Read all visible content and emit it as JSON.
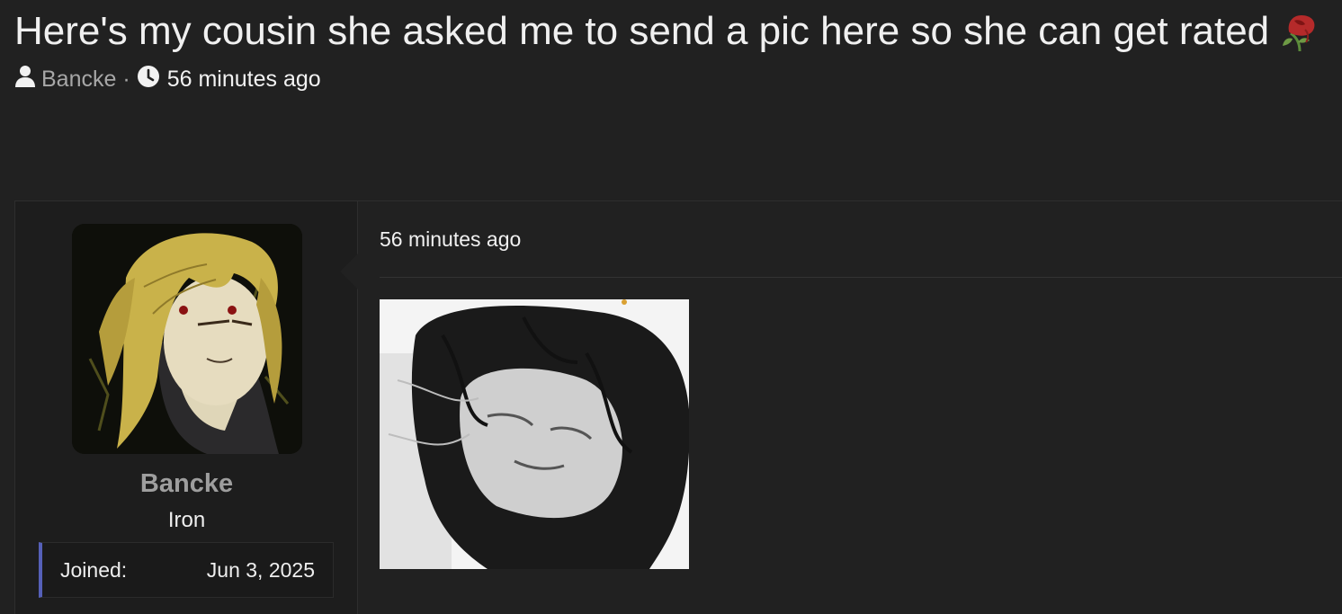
{
  "thread": {
    "title": "Here's my cousin she asked me to send a pic here so she can get rated",
    "title_emoji": "wilted-rose-icon",
    "author": "Bancke",
    "separator": "·",
    "posted": "56 minutes ago"
  },
  "post": {
    "user": {
      "name": "Bancke",
      "rank": "Iron",
      "joined_label": "Joined:",
      "joined_value": "Jun 3, 2025",
      "accent_color": "#5560b8"
    },
    "date": "56 minutes ago",
    "attachment_icon": "image-attachment"
  },
  "icons": {
    "user": "user-icon",
    "clock": "clock-icon"
  }
}
